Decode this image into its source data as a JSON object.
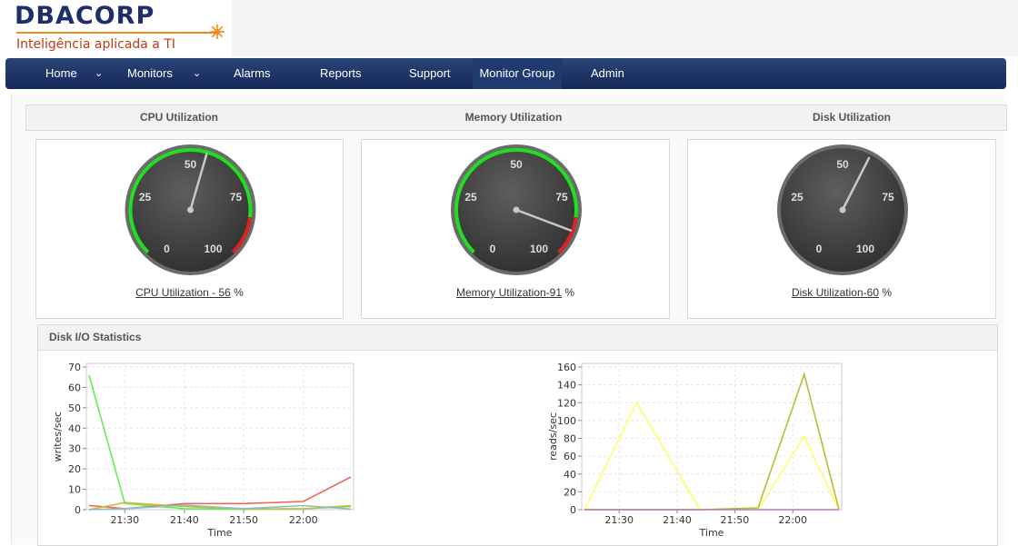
{
  "brand": {
    "name": "DBACORP",
    "tagline": "Inteligência aplicada a TI"
  },
  "nav": {
    "items": [
      {
        "label": "Home",
        "has_dropdown": true
      },
      {
        "label": "Monitors",
        "has_dropdown": true
      },
      {
        "label": "Alarms",
        "has_dropdown": false
      },
      {
        "label": "Reports",
        "has_dropdown": false
      },
      {
        "label": "Support",
        "has_dropdown": false
      },
      {
        "label": "Monitor Group",
        "has_dropdown": false,
        "active": true
      },
      {
        "label": "Admin",
        "has_dropdown": false
      }
    ]
  },
  "utilization": {
    "cpu_title": "CPU Utilization",
    "memory_title": "Memory Utilization",
    "disk_title": "Disk Utilization"
  },
  "gauges": [
    {
      "id": "cpu",
      "value": 56,
      "ticks": [
        "0",
        "25",
        "50",
        "75",
        "100"
      ],
      "caption_link": "CPU Utilization - 56",
      "caption_suffix": " %",
      "band_color": "#22dd22",
      "critical_color": "#dd2222",
      "show_bands": true
    },
    {
      "id": "memory",
      "value": 91,
      "ticks": [
        "0",
        "25",
        "50",
        "75",
        "100"
      ],
      "caption_link": "Memory Utilization-91",
      "caption_suffix": " %",
      "band_color": "#22dd22",
      "critical_color": "#dd2222",
      "show_bands": true
    },
    {
      "id": "disk",
      "value": 60,
      "ticks": [
        "0",
        "25",
        "50",
        "75",
        "100"
      ],
      "caption_link": "Disk Utilization-60",
      "caption_suffix": " %",
      "band_color": "#22dd22",
      "critical_color": "#dd2222",
      "show_bands": false
    }
  ],
  "disk_io": {
    "title": "Disk I/O Statistics"
  },
  "chart_data": [
    {
      "type": "line",
      "ylabel": "writes/sec",
      "xlabel": "Time",
      "x_ticks": [
        "21:30",
        "21:40",
        "21:50",
        "22:00"
      ],
      "ylim": [
        0,
        70
      ],
      "y_ticks": [
        0,
        10,
        20,
        30,
        40,
        50,
        60,
        70
      ],
      "grid": true,
      "series": [
        {
          "color": "#66ee55",
          "points": [
            [
              21.4,
              66
            ],
            [
              21.5,
              3
            ],
            [
              21.667,
              0.5
            ],
            [
              21.833,
              0.2
            ],
            [
              22.0,
              0.5
            ],
            [
              22.133,
              1.5
            ]
          ]
        },
        {
          "color": "#ee6655",
          "points": [
            [
              21.4,
              2
            ],
            [
              21.5,
              0.5
            ],
            [
              21.667,
              3
            ],
            [
              21.833,
              3
            ],
            [
              22.0,
              4
            ],
            [
              22.133,
              16
            ]
          ]
        },
        {
          "color": "#ccbb33",
          "points": [
            [
              21.4,
              0
            ],
            [
              21.5,
              3.5
            ],
            [
              21.667,
              1.5
            ],
            [
              21.833,
              0.3
            ],
            [
              22.0,
              0.5
            ],
            [
              22.133,
              2
            ]
          ]
        },
        {
          "color": "#88bbcc",
          "points": [
            [
              21.4,
              0
            ],
            [
              21.5,
              0.5
            ],
            [
              21.667,
              2.2
            ],
            [
              21.833,
              0.5
            ],
            [
              22.0,
              2
            ],
            [
              22.133,
              0.3
            ]
          ]
        }
      ]
    },
    {
      "type": "line",
      "ylabel": "reads/sec",
      "xlabel": "Time",
      "x_ticks": [
        "21:30",
        "21:40",
        "21:50",
        "22:00"
      ],
      "ylim": [
        0,
        160
      ],
      "y_ticks": [
        0,
        20,
        40,
        60,
        80,
        100,
        120,
        140,
        160
      ],
      "grid": true,
      "series": [
        {
          "color": "#ffff66",
          "points": [
            [
              21.4,
              0
            ],
            [
              21.55,
              120
            ],
            [
              21.733,
              0
            ],
            [
              21.9,
              0
            ],
            [
              22.033,
              82
            ],
            [
              22.133,
              0
            ]
          ]
        },
        {
          "color": "#bbbb33",
          "points": [
            [
              21.4,
              0
            ],
            [
              21.55,
              0
            ],
            [
              21.733,
              0
            ],
            [
              21.9,
              2
            ],
            [
              22.033,
              152
            ],
            [
              22.133,
              0
            ]
          ]
        },
        {
          "color": "#bb77bb",
          "points": [
            [
              21.4,
              0
            ],
            [
              21.55,
              0
            ],
            [
              21.733,
              0
            ],
            [
              21.9,
              0
            ],
            [
              22.033,
              0
            ],
            [
              22.133,
              0
            ]
          ]
        }
      ]
    }
  ]
}
